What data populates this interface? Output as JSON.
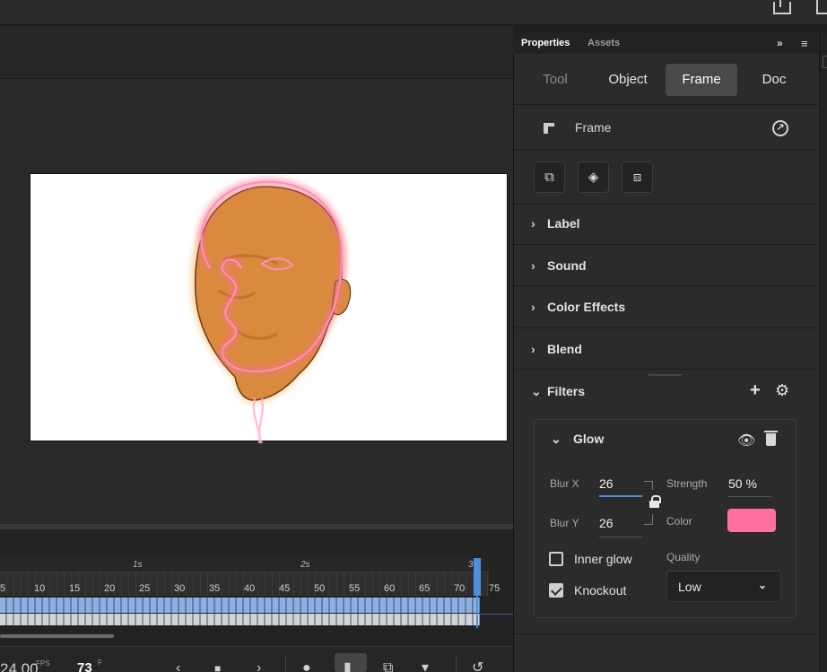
{
  "panel": {
    "tabs": [
      "Properties",
      "Assets"
    ],
    "expand_glyph": "»",
    "menu_glyph": "≡",
    "segments": [
      "Tool",
      "Object",
      "Frame",
      "Doc"
    ],
    "selected_segment": "Frame",
    "header": {
      "title": "Frame",
      "icon": "frame-icon",
      "action_icon": "arrow-up-right-circle-icon"
    },
    "tool_buttons": [
      "convert-to-keyframe-icon",
      "keyframe-diamond-icon",
      "insert-blank-keyframe-icon"
    ],
    "sections": [
      "Label",
      "Sound",
      "Color Effects",
      "Blend"
    ],
    "filters": {
      "title": "Filters",
      "glow": {
        "title": "Glow",
        "blur_x_label": "Blur X",
        "blur_x": "26",
        "blur_y_label": "Blur Y",
        "blur_y": "26",
        "strength_label": "Strength",
        "strength": "50 %",
        "color_label": "Color",
        "color": "#ff6fa1",
        "inner_glow_label": "Inner glow",
        "inner_glow_checked": false,
        "knockout_label": "Knockout",
        "knockout_checked": true,
        "quality_label": "Quality",
        "quality": "Low"
      }
    }
  },
  "timeline": {
    "seconds": [
      "1s",
      "2s",
      "3"
    ],
    "frame_numbers": [
      "5",
      "10",
      "15",
      "20",
      "25",
      "30",
      "35",
      "40",
      "45",
      "50",
      "55",
      "60",
      "65",
      "70",
      "75"
    ],
    "current_frame": 73
  },
  "bottom": {
    "fps": "24.00",
    "fps_unit": "FPS",
    "frame": "73",
    "frame_unit": "F"
  },
  "colors": {
    "accent": "#4a8fe0",
    "glow_pink": "#ff6fa1",
    "skin": "#d98a3c"
  }
}
